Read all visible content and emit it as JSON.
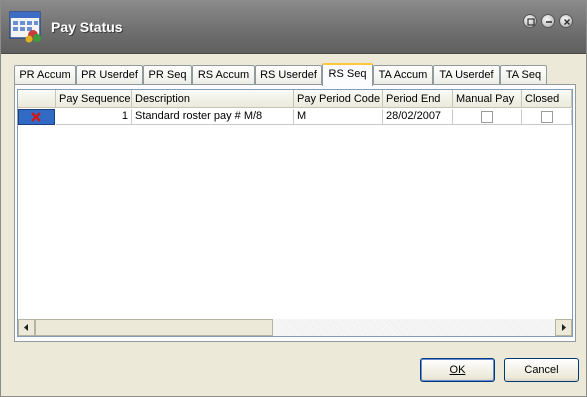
{
  "window": {
    "title": "Pay Status",
    "app_icon": "pay-status-app-icon",
    "controls": [
      "restore-icon",
      "minimize-icon",
      "close-icon"
    ]
  },
  "tabs": [
    {
      "label": "PR Accum",
      "active": false
    },
    {
      "label": "PR Userdef",
      "active": false
    },
    {
      "label": "PR Seq",
      "active": false
    },
    {
      "label": "RS Accum",
      "active": false
    },
    {
      "label": "RS Userdef",
      "active": false
    },
    {
      "label": "RS Seq",
      "active": true
    },
    {
      "label": "TA Accum",
      "active": false
    },
    {
      "label": "TA Userdef",
      "active": false
    },
    {
      "label": "TA Seq",
      "active": false
    }
  ],
  "grid": {
    "columns": [
      "Pay Sequence",
      "Description",
      "Pay Period Code",
      "Period End",
      "Manual Pay",
      "Closed"
    ],
    "rows": [
      {
        "pay_sequence": "1",
        "description": "Standard roster pay # M/8",
        "pay_period_code": "M",
        "period_end": "28/02/2007",
        "manual_pay": false,
        "closed": false
      }
    ],
    "row_indicator_icon": "delete-x-icon"
  },
  "buttons": {
    "ok_label": "OK",
    "cancel_label": "Cancel"
  },
  "colors": {
    "selection": "#316ac5",
    "active_tab_accent": "#ffc83c",
    "titlebar": "#6e6e6e"
  }
}
